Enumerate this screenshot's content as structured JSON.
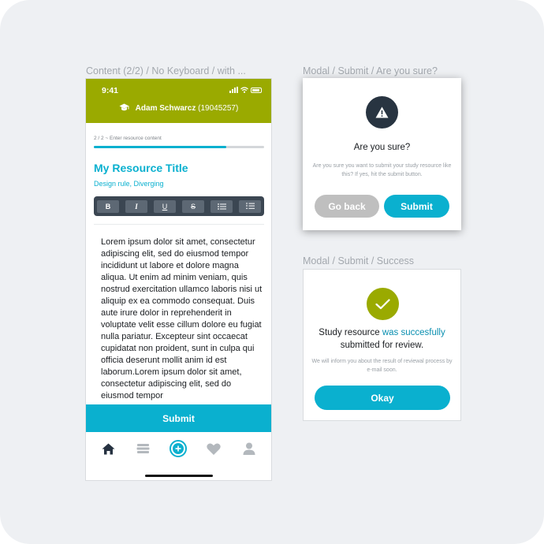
{
  "frames": {
    "phone": "Content (2/2) / No Keyboard / with ...",
    "modal_confirm": "Modal / Submit / Are you sure?",
    "modal_success": "Modal / Submit / Success"
  },
  "phone": {
    "status_time": "9:41",
    "user_name": "Adam Schwarcz",
    "user_id": "(19045257)",
    "step_label": "2 / 2  ~  Enter resource content",
    "progress": 0.78,
    "resource_title": "My Resource Title",
    "resource_tags": "Design rule, Diverging",
    "toolbar": {
      "bold": "B",
      "italic": "I",
      "underline": "U",
      "strike": "S"
    },
    "body_text": "Lorem ipsum dolor sit amet, consectetur adipiscing elit, sed do eiusmod tempor incididunt ut labore et dolore magna aliqua. Ut enim ad minim veniam, quis nostrud exercitation ullamco laboris nisi ut aliquip ex ea commodo consequat. Duis aute irure dolor in reprehenderit in voluptate velit esse cillum dolore eu fugiat nulla pariatur. Excepteur sint occaecat cupidatat non proident, sunt in culpa qui officia deserunt mollit anim id est laborum.Lorem ipsum dolor sit amet, consectetur adipiscing elit, sed do eiusmod tempor",
    "submit_label": "Submit",
    "tabs": [
      "home-icon",
      "library-icon",
      "add-icon",
      "heart-icon",
      "profile-icon"
    ]
  },
  "modal_confirm": {
    "title": "Are you sure?",
    "description": "Are you sure you want to submit your study resource like this? If yes, hit the submit button.",
    "back_label": "Go back",
    "submit_label": "Submit"
  },
  "modal_success": {
    "title_part1": "Study resource ",
    "title_highlight": "was succesfully",
    "title_part2": "submitted for review.",
    "description": "We will inform you about the result of reviewal process by e-mail soon.",
    "okay_label": "Okay"
  },
  "colors": {
    "accent": "#0ab0cf",
    "brand": "#9aaa00",
    "dark": "#283441",
    "muted": "#bfbfbf"
  }
}
